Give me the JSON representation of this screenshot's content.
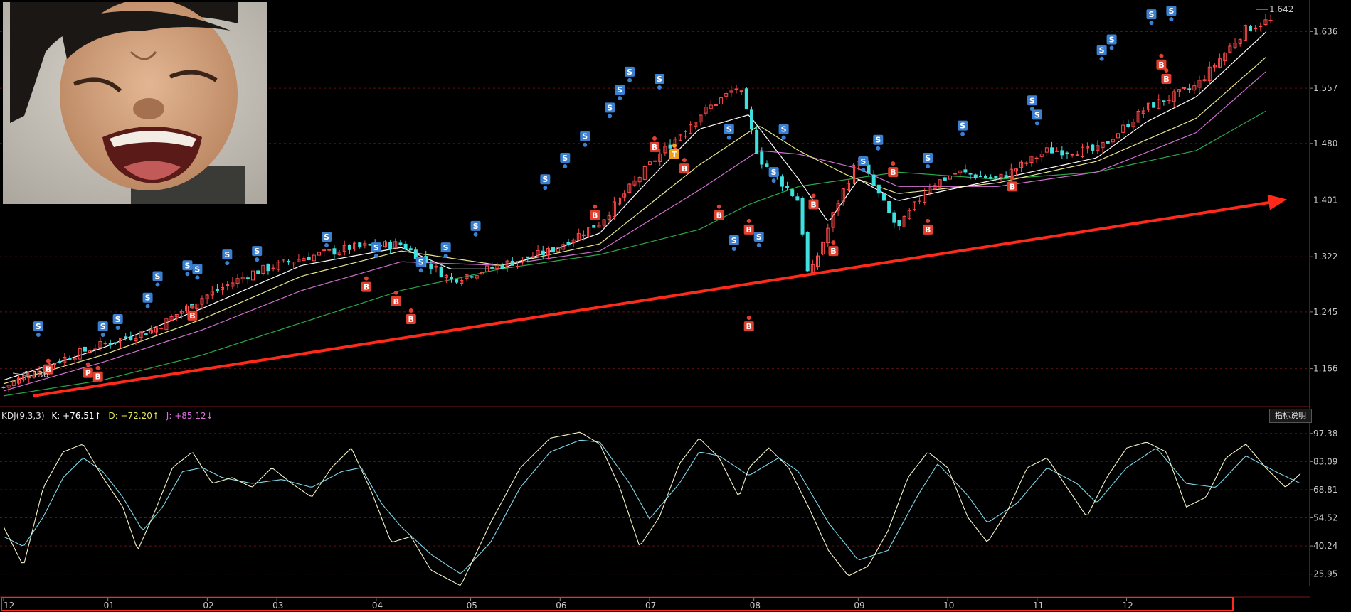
{
  "price_panel": {
    "y_ticks": [
      "1.636",
      "1.557",
      "1.480",
      "1.401",
      "1.322",
      "1.245",
      "1.166"
    ],
    "low_label": "1.136",
    "high_label": "1.642",
    "trend_arrow_color": "#ff2a1a",
    "up_color": "#ff4a4a",
    "down_color": "#3fe0e0"
  },
  "kdj_panel": {
    "title": "KDJ(9,3,3)",
    "k_text": "K: +76.51↑",
    "d_text": "D: +72.20↑",
    "j_text": "J: +85.12↓",
    "y_ticks": [
      "97.38",
      "83.09",
      "68.81",
      "54.52",
      "40.24",
      "25.95"
    ],
    "explain_button": "指标说明"
  },
  "x_axis": {
    "months": [
      "12",
      "01",
      "02",
      "03",
      "04",
      "05",
      "06",
      "07",
      "08",
      "09",
      "10",
      "11",
      "12"
    ],
    "highlight_color": "#ff2a1a"
  },
  "signals": {
    "buy": "B",
    "sell": "S",
    "t": "T",
    "p": "P"
  },
  "chart_data": {
    "type": "candlestick",
    "y_range": [
      1.12,
      1.68
    ],
    "kdj_range": [
      15,
      102
    ],
    "months": [
      "12",
      "01",
      "02",
      "03",
      "04",
      "05",
      "06",
      "07",
      "08",
      "09",
      "10",
      "11",
      "12"
    ],
    "close_path": [
      [
        0,
        1.14
      ],
      [
        0.5,
        1.175
      ],
      [
        1,
        1.2
      ],
      [
        1.5,
        1.22
      ],
      [
        2,
        1.265
      ],
      [
        2.5,
        1.3
      ],
      [
        3,
        1.32
      ],
      [
        3.5,
        1.335
      ],
      [
        4,
        1.34
      ],
      [
        4.5,
        1.29
      ],
      [
        5,
        1.31
      ],
      [
        5.5,
        1.33
      ],
      [
        6,
        1.37
      ],
      [
        6.5,
        1.45
      ],
      [
        7,
        1.52
      ],
      [
        7.4,
        1.56
      ],
      [
        7.6,
        1.46
      ],
      [
        8,
        1.4
      ],
      [
        8.1,
        1.29
      ],
      [
        8.4,
        1.4
      ],
      [
        8.6,
        1.46
      ],
      [
        9,
        1.36
      ],
      [
        9.3,
        1.42
      ],
      [
        9.6,
        1.44
      ],
      [
        10,
        1.43
      ],
      [
        10.5,
        1.47
      ],
      [
        11,
        1.47
      ],
      [
        11.5,
        1.53
      ],
      [
        12,
        1.56
      ],
      [
        12.5,
        1.64
      ],
      [
        12.7,
        1.65
      ]
    ],
    "ma_short_path": [
      [
        0,
        1.15
      ],
      [
        1,
        1.195
      ],
      [
        2,
        1.25
      ],
      [
        3,
        1.31
      ],
      [
        4,
        1.335
      ],
      [
        4.5,
        1.305
      ],
      [
        5,
        1.305
      ],
      [
        6,
        1.355
      ],
      [
        6.5,
        1.43
      ],
      [
        7,
        1.5
      ],
      [
        7.5,
        1.52
      ],
      [
        8,
        1.43
      ],
      [
        8.3,
        1.37
      ],
      [
        8.6,
        1.43
      ],
      [
        9,
        1.4
      ],
      [
        9.5,
        1.415
      ],
      [
        10,
        1.43
      ],
      [
        11,
        1.46
      ],
      [
        11.5,
        1.51
      ],
      [
        12,
        1.545
      ],
      [
        12.7,
        1.635
      ]
    ],
    "ma_mid_path": [
      [
        0,
        1.145
      ],
      [
        1,
        1.185
      ],
      [
        2,
        1.235
      ],
      [
        3,
        1.295
      ],
      [
        4,
        1.33
      ],
      [
        5,
        1.31
      ],
      [
        6,
        1.34
      ],
      [
        7,
        1.45
      ],
      [
        7.6,
        1.505
      ],
      [
        8,
        1.47
      ],
      [
        8.5,
        1.435
      ],
      [
        9,
        1.41
      ],
      [
        10,
        1.425
      ],
      [
        11,
        1.455
      ],
      [
        12,
        1.515
      ],
      [
        12.7,
        1.6
      ]
    ],
    "ma_long_path": [
      [
        0,
        1.135
      ],
      [
        1,
        1.175
      ],
      [
        2,
        1.22
      ],
      [
        3,
        1.275
      ],
      [
        4,
        1.315
      ],
      [
        5,
        1.31
      ],
      [
        6,
        1.33
      ],
      [
        7,
        1.415
      ],
      [
        7.6,
        1.47
      ],
      [
        8,
        1.465
      ],
      [
        8.6,
        1.445
      ],
      [
        9,
        1.42
      ],
      [
        10,
        1.42
      ],
      [
        11,
        1.44
      ],
      [
        12,
        1.495
      ],
      [
        12.7,
        1.58
      ]
    ],
    "ma_trend_path": [
      [
        0,
        1.128
      ],
      [
        1,
        1.15
      ],
      [
        2,
        1.185
      ],
      [
        3,
        1.23
      ],
      [
        4,
        1.275
      ],
      [
        5,
        1.305
      ],
      [
        6,
        1.325
      ],
      [
        7,
        1.36
      ],
      [
        7.5,
        1.395
      ],
      [
        8,
        1.42
      ],
      [
        9,
        1.44
      ],
      [
        10,
        1.43
      ],
      [
        11,
        1.44
      ],
      [
        12,
        1.47
      ],
      [
        12.7,
        1.525
      ]
    ],
    "trend_arrow": {
      "from": [
        0.3,
        1.128
      ],
      "to": [
        13.0,
        1.401
      ]
    },
    "signals": [
      {
        "t": 0.35,
        "p": 1.225,
        "label": "S"
      },
      {
        "t": 0.45,
        "p": 1.165,
        "label": "B"
      },
      {
        "t": 0.85,
        "p": 1.16,
        "label": "P"
      },
      {
        "t": 0.95,
        "p": 1.155,
        "label": "B"
      },
      {
        "t": 1.0,
        "p": 1.225,
        "label": "S"
      },
      {
        "t": 1.15,
        "p": 1.235,
        "label": "S"
      },
      {
        "t": 1.45,
        "p": 1.265,
        "label": "S"
      },
      {
        "t": 1.55,
        "p": 1.295,
        "label": "S"
      },
      {
        "t": 1.85,
        "p": 1.31,
        "label": "S"
      },
      {
        "t": 1.95,
        "p": 1.305,
        "label": "S"
      },
      {
        "t": 1.9,
        "p": 1.24,
        "label": "B"
      },
      {
        "t": 2.25,
        "p": 1.325,
        "label": "S"
      },
      {
        "t": 2.55,
        "p": 1.33,
        "label": "S"
      },
      {
        "t": 3.25,
        "p": 1.35,
        "label": "S"
      },
      {
        "t": 3.75,
        "p": 1.335,
        "label": "S"
      },
      {
        "t": 3.65,
        "p": 1.28,
        "label": "B"
      },
      {
        "t": 3.95,
        "p": 1.26,
        "label": "B"
      },
      {
        "t": 4.1,
        "p": 1.235,
        "label": "B"
      },
      {
        "t": 4.2,
        "p": 1.315,
        "label": "S"
      },
      {
        "t": 4.45,
        "p": 1.335,
        "label": "S"
      },
      {
        "t": 4.75,
        "p": 1.365,
        "label": "S"
      },
      {
        "t": 5.45,
        "p": 1.43,
        "label": "S"
      },
      {
        "t": 5.65,
        "p": 1.46,
        "label": "S"
      },
      {
        "t": 5.85,
        "p": 1.49,
        "label": "S"
      },
      {
        "t": 5.95,
        "p": 1.38,
        "label": "B"
      },
      {
        "t": 6.1,
        "p": 1.53,
        "label": "S"
      },
      {
        "t": 6.2,
        "p": 1.555,
        "label": "S"
      },
      {
        "t": 6.3,
        "p": 1.58,
        "label": "S"
      },
      {
        "t": 6.6,
        "p": 1.57,
        "label": "S"
      },
      {
        "t": 6.55,
        "p": 1.475,
        "label": "B"
      },
      {
        "t": 6.85,
        "p": 1.445,
        "label": "B"
      },
      {
        "t": 6.75,
        "p": 1.465,
        "label": "T"
      },
      {
        "t": 7.3,
        "p": 1.5,
        "label": "S"
      },
      {
        "t": 7.2,
        "p": 1.38,
        "label": "B"
      },
      {
        "t": 7.5,
        "p": 1.36,
        "label": "B"
      },
      {
        "t": 7.6,
        "p": 1.35,
        "label": "S"
      },
      {
        "t": 7.35,
        "p": 1.345,
        "label": "S"
      },
      {
        "t": 7.5,
        "p": 1.225,
        "label": "B"
      },
      {
        "t": 7.85,
        "p": 1.5,
        "label": "S"
      },
      {
        "t": 7.75,
        "p": 1.44,
        "label": "S"
      },
      {
        "t": 8.15,
        "p": 1.395,
        "label": "B"
      },
      {
        "t": 8.35,
        "p": 1.33,
        "label": "B"
      },
      {
        "t": 8.65,
        "p": 1.455,
        "label": "S"
      },
      {
        "t": 8.8,
        "p": 1.485,
        "label": "S"
      },
      {
        "t": 8.95,
        "p": 1.44,
        "label": "B"
      },
      {
        "t": 9.3,
        "p": 1.46,
        "label": "S"
      },
      {
        "t": 9.3,
        "p": 1.36,
        "label": "B"
      },
      {
        "t": 9.65,
        "p": 1.505,
        "label": "S"
      },
      {
        "t": 10.15,
        "p": 1.42,
        "label": "B"
      },
      {
        "t": 10.35,
        "p": 1.54,
        "label": "S"
      },
      {
        "t": 10.4,
        "p": 1.52,
        "label": "S"
      },
      {
        "t": 11.05,
        "p": 1.61,
        "label": "S"
      },
      {
        "t": 11.15,
        "p": 1.625,
        "label": "S"
      },
      {
        "t": 11.55,
        "p": 1.66,
        "label": "S"
      },
      {
        "t": 11.75,
        "p": 1.665,
        "label": "S"
      },
      {
        "t": 11.65,
        "p": 1.59,
        "label": "B"
      },
      {
        "t": 11.7,
        "p": 1.57,
        "label": "B"
      }
    ],
    "kdj_k": [
      [
        0,
        50
      ],
      [
        0.1,
        40
      ],
      [
        0.2,
        30
      ],
      [
        0.4,
        70
      ],
      [
        0.6,
        88
      ],
      [
        0.8,
        92
      ],
      [
        1.0,
        75
      ],
      [
        1.2,
        60
      ],
      [
        1.35,
        38
      ],
      [
        1.5,
        55
      ],
      [
        1.7,
        80
      ],
      [
        1.9,
        88
      ],
      [
        2.1,
        72
      ],
      [
        2.3,
        75
      ],
      [
        2.5,
        70
      ],
      [
        2.7,
        80
      ],
      [
        2.9,
        72
      ],
      [
        3.1,
        65
      ],
      [
        3.3,
        80
      ],
      [
        3.5,
        90
      ],
      [
        3.7,
        68
      ],
      [
        3.9,
        42
      ],
      [
        4.1,
        45
      ],
      [
        4.3,
        28
      ],
      [
        4.6,
        20
      ],
      [
        4.9,
        52
      ],
      [
        5.2,
        80
      ],
      [
        5.5,
        95
      ],
      [
        5.8,
        98
      ],
      [
        6.0,
        92
      ],
      [
        6.2,
        70
      ],
      [
        6.4,
        40
      ],
      [
        6.6,
        55
      ],
      [
        6.8,
        82
      ],
      [
        7.0,
        95
      ],
      [
        7.2,
        85
      ],
      [
        7.4,
        65
      ],
      [
        7.5,
        80
      ],
      [
        7.7,
        90
      ],
      [
        7.9,
        80
      ],
      [
        8.1,
        60
      ],
      [
        8.3,
        38
      ],
      [
        8.5,
        25
      ],
      [
        8.7,
        30
      ],
      [
        8.9,
        48
      ],
      [
        9.1,
        75
      ],
      [
        9.3,
        88
      ],
      [
        9.5,
        80
      ],
      [
        9.7,
        55
      ],
      [
        9.9,
        42
      ],
      [
        10.1,
        58
      ],
      [
        10.3,
        80
      ],
      [
        10.5,
        85
      ],
      [
        10.7,
        70
      ],
      [
        10.9,
        55
      ],
      [
        11.1,
        75
      ],
      [
        11.3,
        90
      ],
      [
        11.5,
        93
      ],
      [
        11.7,
        88
      ],
      [
        11.9,
        60
      ],
      [
        12.1,
        65
      ],
      [
        12.3,
        85
      ],
      [
        12.5,
        92
      ],
      [
        12.7,
        80
      ],
      [
        12.9,
        70
      ],
      [
        13.05,
        77
      ]
    ],
    "kdj_d": [
      [
        0,
        45
      ],
      [
        0.2,
        40
      ],
      [
        0.4,
        55
      ],
      [
        0.6,
        75
      ],
      [
        0.8,
        85
      ],
      [
        1.0,
        78
      ],
      [
        1.2,
        65
      ],
      [
        1.4,
        48
      ],
      [
        1.6,
        60
      ],
      [
        1.8,
        78
      ],
      [
        2.0,
        80
      ],
      [
        2.2,
        75
      ],
      [
        2.5,
        72
      ],
      [
        2.8,
        74
      ],
      [
        3.1,
        70
      ],
      [
        3.4,
        78
      ],
      [
        3.6,
        80
      ],
      [
        3.8,
        62
      ],
      [
        4.0,
        50
      ],
      [
        4.3,
        36
      ],
      [
        4.6,
        26
      ],
      [
        4.9,
        42
      ],
      [
        5.2,
        70
      ],
      [
        5.5,
        88
      ],
      [
        5.8,
        94
      ],
      [
        6.0,
        93
      ],
      [
        6.3,
        72
      ],
      [
        6.5,
        54
      ],
      [
        6.8,
        72
      ],
      [
        7.0,
        88
      ],
      [
        7.2,
        86
      ],
      [
        7.5,
        76
      ],
      [
        7.8,
        85
      ],
      [
        8.0,
        78
      ],
      [
        8.3,
        52
      ],
      [
        8.6,
        33
      ],
      [
        8.9,
        38
      ],
      [
        9.2,
        66
      ],
      [
        9.4,
        82
      ],
      [
        9.7,
        66
      ],
      [
        9.9,
        52
      ],
      [
        10.2,
        62
      ],
      [
        10.5,
        80
      ],
      [
        10.8,
        72
      ],
      [
        11.0,
        62
      ],
      [
        11.3,
        80
      ],
      [
        11.6,
        90
      ],
      [
        11.9,
        72
      ],
      [
        12.2,
        70
      ],
      [
        12.5,
        86
      ],
      [
        12.8,
        78
      ],
      [
        13.05,
        72
      ]
    ]
  }
}
